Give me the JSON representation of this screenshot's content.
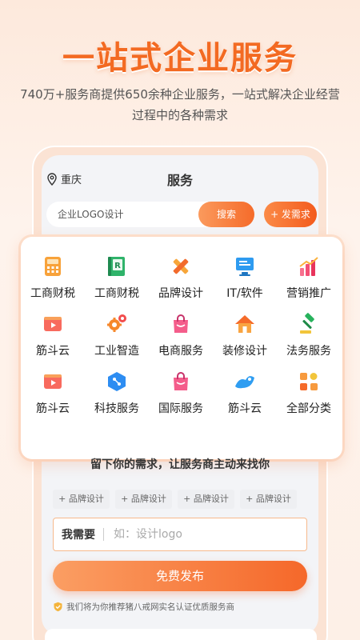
{
  "headline": "一站式企业服务",
  "subline": "740万+服务商提供650余种企业服务，一站式解决企业经营过程中的各种需求",
  "app": {
    "location": "重庆",
    "title": "服务",
    "search_placeholder": "企业LOGO设计",
    "search_button": "搜索",
    "post_button": "+ 发需求"
  },
  "categories": [
    {
      "label": "工商财税",
      "icon": "calculator-icon"
    },
    {
      "label": "工商财税",
      "icon": "ledger-icon"
    },
    {
      "label": "品牌设计",
      "icon": "pencil-ruler-icon"
    },
    {
      "label": "IT/软件",
      "icon": "monitor-icon"
    },
    {
      "label": "营销推广",
      "icon": "bar-chart-icon"
    },
    {
      "label": "筋斗云",
      "icon": "play-window-icon"
    },
    {
      "label": "工业智造",
      "icon": "gears-icon"
    },
    {
      "label": "电商服务",
      "icon": "shopping-bag-icon"
    },
    {
      "label": "装修设计",
      "icon": "house-icon"
    },
    {
      "label": "法务服务",
      "icon": "gavel-icon"
    },
    {
      "label": "筋斗云",
      "icon": "play-window-icon"
    },
    {
      "label": "科技服务",
      "icon": "tech-cube-icon"
    },
    {
      "label": "国际服务",
      "icon": "shopping-bag-icon"
    },
    {
      "label": "筋斗云",
      "icon": "cloud-wave-icon"
    },
    {
      "label": "全部分类",
      "icon": "all-grid-icon"
    }
  ],
  "demand": {
    "prompt": "留下你的需求，让服务商主动来找你",
    "tags": [
      "+ 品牌设计",
      "+ 品牌设计",
      "+ 品牌设计",
      "+ 品牌设计"
    ],
    "need_label": "我需要",
    "need_placeholder": "如：设计logo",
    "publish_button": "免费发布",
    "note": "我们将为你推荐猪八戒网实名认证优质服务商"
  },
  "colors": {
    "accent": "#f56b2a",
    "headline": "#f36a22"
  }
}
